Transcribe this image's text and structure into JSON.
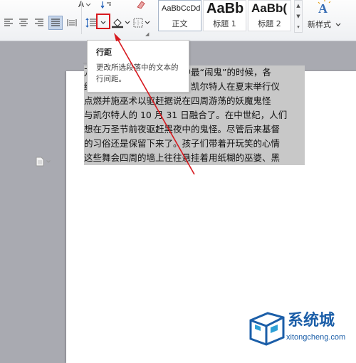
{
  "ribbon": {
    "styles": [
      {
        "sample": "AaBbCcDd",
        "name": "正文"
      },
      {
        "sample": "AaBb",
        "name": "标题 1"
      },
      {
        "sample": "AaBb(",
        "name": "标题 2"
      }
    ],
    "new_style_label": "新样式",
    "new_style_icon_text": "A",
    "font_color_letter": "A"
  },
  "tooltip": {
    "title": "行距",
    "description": "更改所选段落中的文本的行间距。"
  },
  "document": {
    "lines": [
      "万圣节前一天夜里是一年中最“闹鬼”的时候，各",
      "纷出动。在基督纪元以前，凯尔特人在夏末举行仪",
      "点燃并施巫术以驱赶据说在四周游荡的妖魔鬼怪",
      "与凯尔特人的 10 月 31 日融合了。在中世纪，人们",
      "想在万圣节前夜驱赶黑夜中的鬼怪。尽管后来基督",
      "的习俗还是保留下来了。孩子们带着开玩笑的心情",
      "这些舞会四周的墙上往往悬挂着用纸糊的巫婆、黑"
    ]
  },
  "watermark": {
    "title": "系统城",
    "url": "xitongcheng.com"
  },
  "colors": {
    "highlight": "#d7191f",
    "selection": "#c8c8c8",
    "watermark": "#1b5ea8"
  }
}
